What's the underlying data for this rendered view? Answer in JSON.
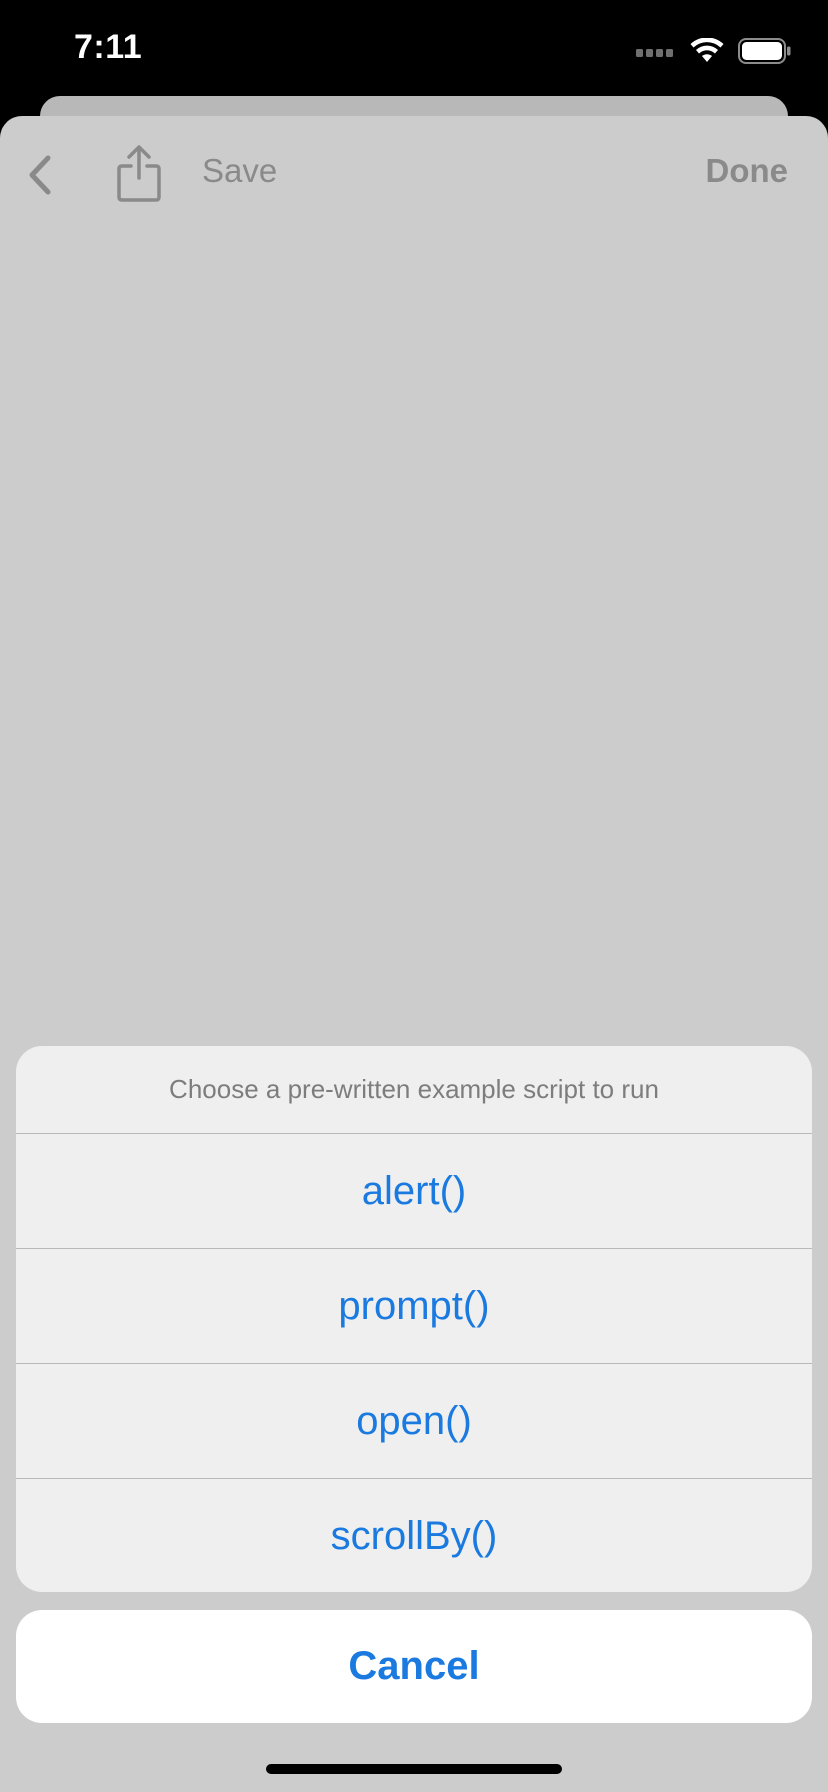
{
  "status_bar": {
    "time": "7:11",
    "icons": [
      "cellular-signal-icon",
      "wifi-icon",
      "battery-icon"
    ]
  },
  "nav": {
    "back_icon": "chevron-left-icon",
    "share_icon": "share-icon",
    "save_label": "Save",
    "done_label": "Done"
  },
  "action_sheet": {
    "title": "Choose a pre-written example script to run",
    "items": [
      {
        "label": "alert()"
      },
      {
        "label": "prompt()"
      },
      {
        "label": "open()"
      },
      {
        "label": "scrollBy()"
      }
    ],
    "cancel_label": "Cancel"
  },
  "colors": {
    "accent": "#1a7ae0",
    "sheet_background": "#cccccc",
    "action_background": "#efefef",
    "status_bar_background": "#000000"
  }
}
